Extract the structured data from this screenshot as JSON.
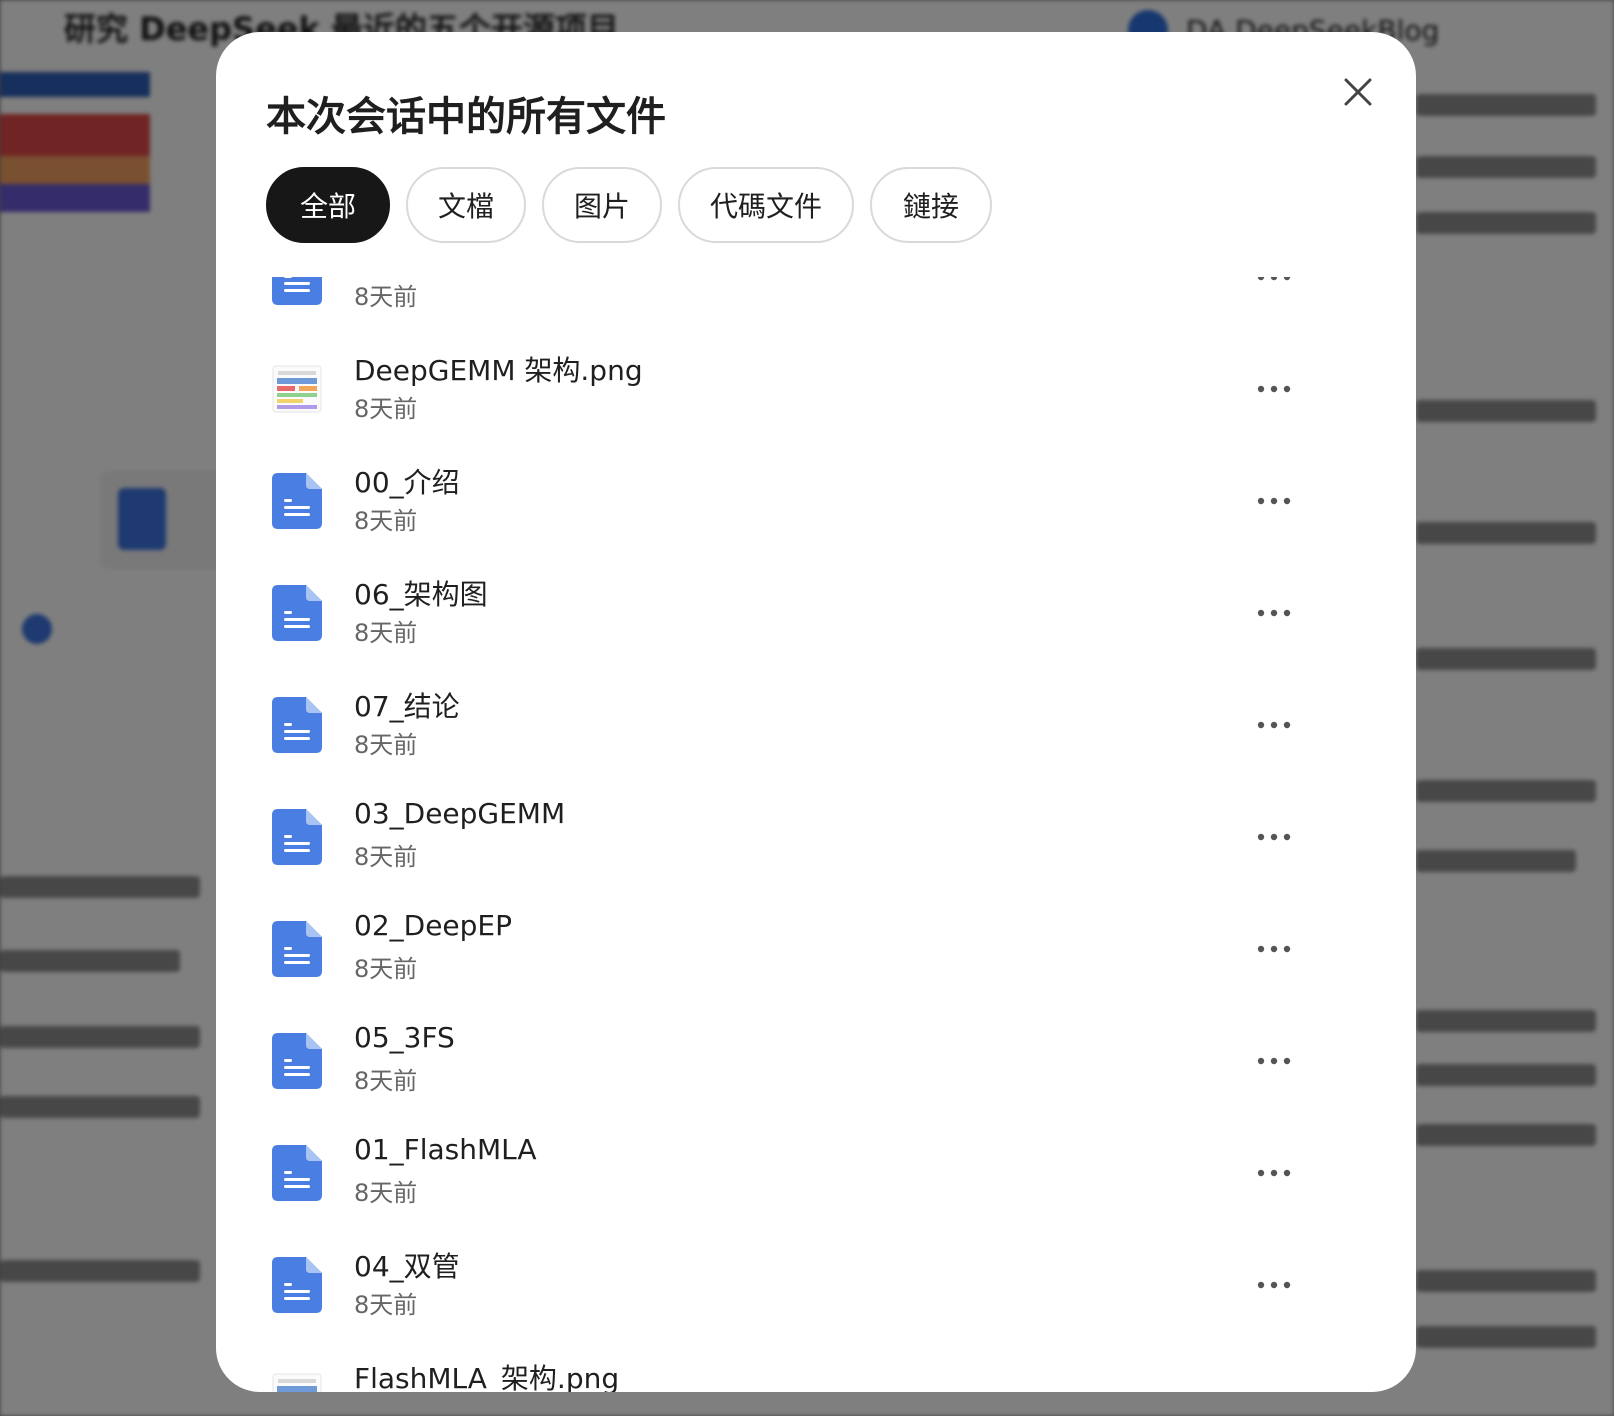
{
  "background": {
    "page_title": "研究 DeepSeek 最近的五个开源项目",
    "user_name": "DA DeepSeekBlog"
  },
  "modal": {
    "title": "本次会话中的所有文件",
    "tabs": [
      {
        "label": "全部",
        "active": true
      },
      {
        "label": "文檔",
        "active": false
      },
      {
        "label": "图片",
        "active": false
      },
      {
        "label": "代碼文件",
        "active": false
      },
      {
        "label": "鏈接",
        "active": false
      }
    ],
    "files": [
      {
        "name": "",
        "time": "8天前",
        "icon": "document-icon"
      },
      {
        "name": "DeepGEMM 架构.png",
        "time": "8天前",
        "icon": "image-thumbnail"
      },
      {
        "name": "00_介绍",
        "time": "8天前",
        "icon": "document-icon"
      },
      {
        "name": "06_架构图",
        "time": "8天前",
        "icon": "document-icon"
      },
      {
        "name": "07_结论",
        "time": "8天前",
        "icon": "document-icon"
      },
      {
        "name": "03_DeepGEMM",
        "time": "8天前",
        "icon": "document-icon"
      },
      {
        "name": "02_DeepEP",
        "time": "8天前",
        "icon": "document-icon"
      },
      {
        "name": "05_3FS",
        "time": "8天前",
        "icon": "document-icon"
      },
      {
        "name": "01_FlashMLA",
        "time": "8天前",
        "icon": "document-icon"
      },
      {
        "name": "04_双管",
        "time": "8天前",
        "icon": "document-icon"
      },
      {
        "name": "FlashMLA_架构.png",
        "time": "8天前",
        "icon": "image-thumbnail"
      }
    ]
  },
  "colors": {
    "doc_blue": "#4a7ee3",
    "active_tab": "#171717",
    "backdrop": "#7f7f7f"
  }
}
